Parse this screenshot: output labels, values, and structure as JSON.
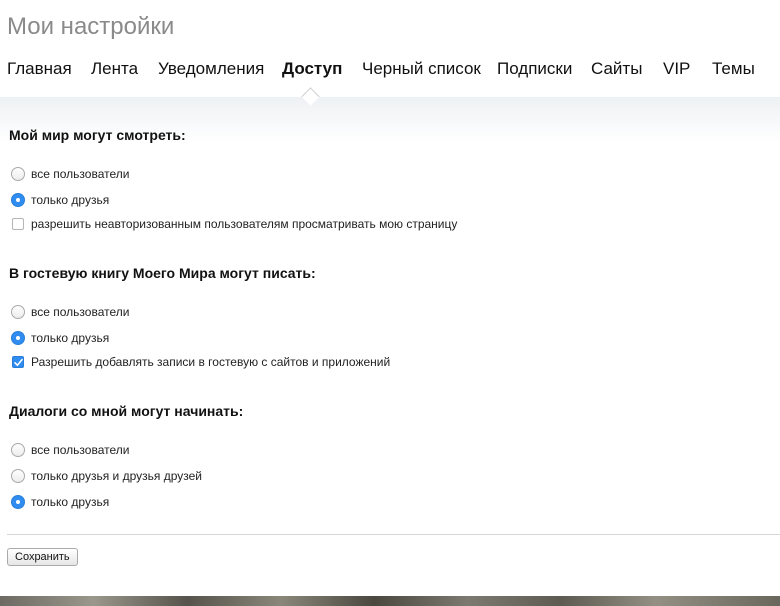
{
  "header": {
    "title": "Мои настройки"
  },
  "tabs": [
    {
      "label": "Главная",
      "active": false
    },
    {
      "label": "Лента",
      "active": false
    },
    {
      "label": "Уведомления",
      "active": false
    },
    {
      "label": "Доступ",
      "active": true
    },
    {
      "label": "Черный список",
      "active": false
    },
    {
      "label": "Подписки",
      "active": false
    },
    {
      "label": "Сайты",
      "active": false
    },
    {
      "label": "VIP",
      "active": false
    },
    {
      "label": "Темы",
      "active": false
    }
  ],
  "sections": [
    {
      "title": "Мой мир могут смотреть:",
      "options": [
        {
          "type": "radio",
          "label": "все пользователи",
          "checked": false
        },
        {
          "type": "radio",
          "label": "только друзья",
          "checked": true
        },
        {
          "type": "checkbox",
          "label": "разрешить неавторизованным пользователям просматривать мою страницу",
          "checked": false
        }
      ]
    },
    {
      "title": "В гостевую книгу Моего Мира могут писать:",
      "options": [
        {
          "type": "radio",
          "label": "все пользователи",
          "checked": false
        },
        {
          "type": "radio",
          "label": "только друзья",
          "checked": true
        },
        {
          "type": "checkbox",
          "label": "Разрешить добавлять записи в гостевую с сайтов и приложений",
          "checked": true
        }
      ]
    },
    {
      "title": "Диалоги со мной могут начинать:",
      "options": [
        {
          "type": "radio",
          "label": "все пользователи",
          "checked": false
        },
        {
          "type": "radio",
          "label": "только друзья и друзья друзей",
          "checked": false
        },
        {
          "type": "radio",
          "label": "только друзья",
          "checked": true
        }
      ]
    }
  ],
  "actions": {
    "save_label": "Сохранить"
  },
  "colors": {
    "accent": "#2f8cf0",
    "title_gray": "#8a8a8a"
  }
}
